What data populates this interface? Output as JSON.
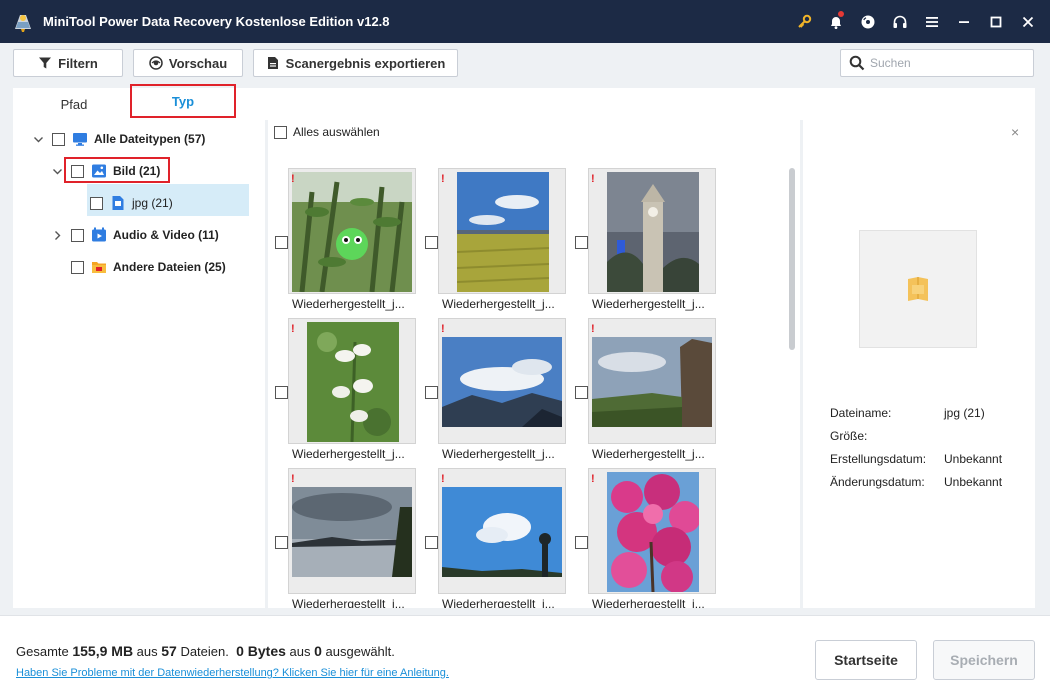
{
  "window": {
    "title": "MiniTool Power Data Recovery Kostenlose Edition v12.8",
    "icons": [
      "key-icon",
      "bell-icon",
      "disc-icon",
      "headset-icon",
      "menu-icon",
      "minimize-icon",
      "maximize-icon",
      "close-icon"
    ],
    "accent_color": "#1c2a45"
  },
  "toolbar": {
    "filter_label": "Filtern",
    "preview_label": "Vorschau",
    "export_label": "Scanergebnis exportieren",
    "search_placeholder": "Suchen"
  },
  "tabs": {
    "path_label": "Pfad",
    "type_label": "Typ",
    "active": "Typ"
  },
  "tree": {
    "all": {
      "label": "Alle Dateitypen (57)"
    },
    "image": {
      "label": "Bild (21)"
    },
    "jpg": {
      "label": "jpg (21)"
    },
    "audio_video": {
      "label": "Audio & Video (11)"
    },
    "other": {
      "label": "Andere Dateien (25)"
    }
  },
  "grid": {
    "select_all_label": "Alles auswählen",
    "items": [
      {
        "caption": "Wiederhergestellt_j...",
        "flag": "!"
      },
      {
        "caption": "Wiederhergestellt_j...",
        "flag": "!"
      },
      {
        "caption": "Wiederhergestellt_j...",
        "flag": "!"
      },
      {
        "caption": "Wiederhergestellt_j...",
        "flag": "!"
      },
      {
        "caption": "Wiederhergestellt_j...",
        "flag": "!"
      },
      {
        "caption": "Wiederhergestellt_j...",
        "flag": "!"
      },
      {
        "caption": "Wiederhergestellt_j...",
        "flag": "!"
      },
      {
        "caption": "Wiederhergestellt_j...",
        "flag": "!"
      },
      {
        "caption": "Wiederhergestellt_j...",
        "flag": "!"
      }
    ]
  },
  "preview": {
    "close_symbol": "×",
    "rows": [
      {
        "key": "Dateiname:",
        "value": "jpg (21)"
      },
      {
        "key": "Größe:",
        "value": ""
      },
      {
        "key": "Erstellungsdatum:",
        "value": "Unbekannt"
      },
      {
        "key": "Änderungsdatum:",
        "value": "Unbekannt"
      }
    ]
  },
  "footer": {
    "summary_prefix": "Gesamte ",
    "total_size": "155,9 MB",
    "summary_mid": " aus ",
    "total_files": "57",
    "summary_files": " Dateien.",
    "selected_size": "0 Bytes",
    "selected_mid": " aus ",
    "selected_count": "0",
    "selected_suffix": " ausgewählt.",
    "help_link": "Haben Sie Probleme mit der Datenwiederherstellung? Klicken Sie hier für eine Anleitung.",
    "home_label": "Startseite",
    "save_label": "Speichern"
  }
}
